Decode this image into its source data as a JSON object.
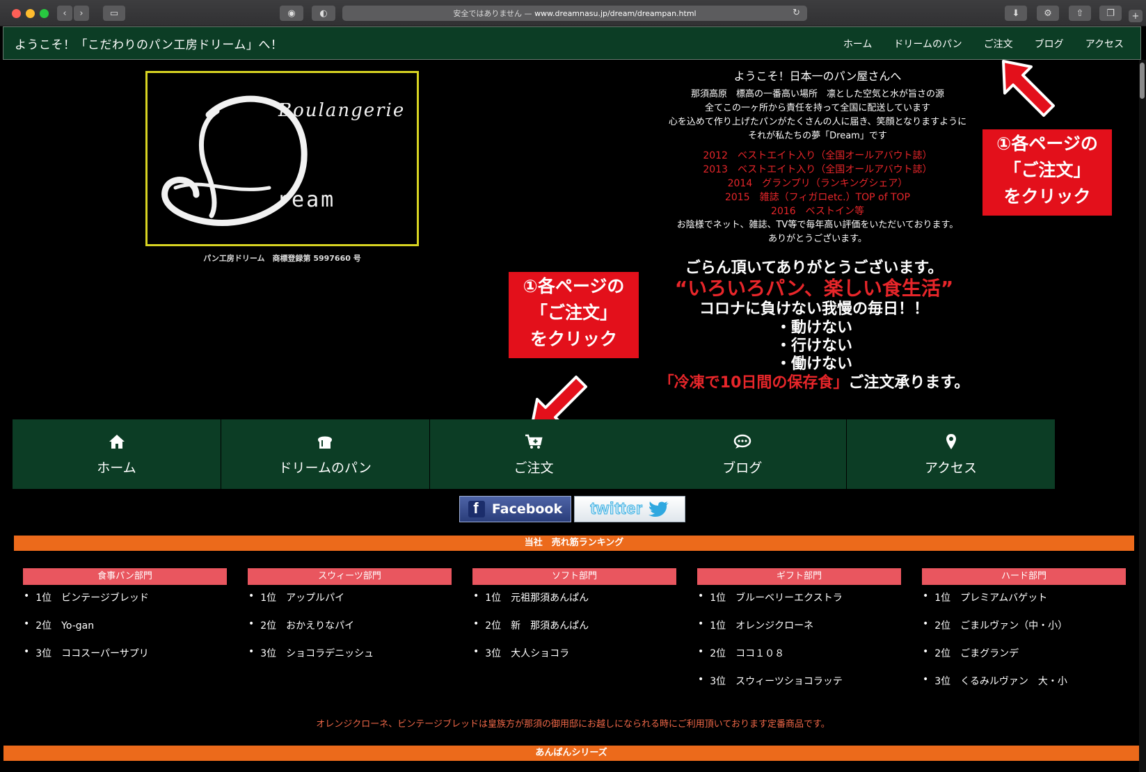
{
  "browser": {
    "url_prefix": "安全ではありません —",
    "url_host_path": "www.dreamnasu.jp/dream/dreampan.html"
  },
  "header": {
    "title": "ようこそ！「こだわりのパン工房ドリーム」へ！",
    "nav": [
      "ホーム",
      "ドリームのパン",
      "ご注文",
      "ブログ",
      "アクセス"
    ]
  },
  "logo": {
    "line1": "Boulangerie",
    "line2": "ream",
    "caption": "パン工房ドリーム　商標登録第 5997660 号"
  },
  "intro": {
    "title": "ようこそ！日本一のパン屋さんへ",
    "lines": [
      "那須高原　標高の一番高い場所　凛とした空気と水が旨さの源",
      "全てこの一ヶ所から責任を持って全国に配送しています",
      "心を込めて作り上げたパンがたくさんの人に届き、笑顔となりますように",
      "それが私たちの夢「Dream」です"
    ],
    "awards": [
      "2012　ベストエイト入り（全国オールアバウト誌）",
      "2013　ベストエイト入り（全国オールアバウト誌）",
      "2014　グランプリ（ランキングシェア）",
      "2015　雑誌（フィガロetc.）TOP of TOP",
      "2016　ベストイン等"
    ],
    "praise": [
      "お陰様でネット、雑誌、TV等で毎年高い評価をいただいております。",
      "ありがとうございます。"
    ]
  },
  "message": {
    "thanks": "ごらん頂いてありがとうございます。",
    "catch": "“いろいろパン、楽しい食生活”",
    "corona": "コロナに負けない我慢の毎日！！",
    "bullets": [
      "・動けない",
      "・行けない",
      "・働けない"
    ],
    "final_red": "「冷凍で10日間の保存食」",
    "final": "ご注文承ります。"
  },
  "callouts": {
    "right": [
      "①各ページの",
      "「ご注文」",
      "をクリック"
    ],
    "mid": [
      "①各ページの",
      "「ご注文」",
      "をクリック"
    ]
  },
  "tiles": [
    {
      "label": "ホーム",
      "icon": "home-icon"
    },
    {
      "label": "ドリームのパン",
      "icon": "bread-icon"
    },
    {
      "label": "ご注文",
      "icon": "cart-plus-icon"
    },
    {
      "label": "ブログ",
      "icon": "chat-icon"
    },
    {
      "label": "アクセス",
      "icon": "map-marker-icon"
    }
  ],
  "social": {
    "facebook": "Facebook",
    "twitter": "twitter"
  },
  "ranking": {
    "title": "当社　売れ筋ランキング",
    "columns": [
      {
        "head": "食事パン部門",
        "items": [
          "1位　ビンテージブレッド",
          "2位　Yo-gan",
          "3位　ココスーパーサプリ"
        ]
      },
      {
        "head": "スウィーツ部門",
        "items": [
          "1位　アップルパイ",
          "2位　おかえりなパイ",
          "3位　ショコラデニッシュ"
        ]
      },
      {
        "head": "ソフト部門",
        "items": [
          "1位　元祖那須あんぱん",
          "2位　新　那須あんぱん",
          "3位　大人ショコラ"
        ]
      },
      {
        "head": "ギフト部門",
        "items": [
          "1位　ブルーベリーエクストラ",
          "1位　オレンジクローネ",
          "2位　ココ１０８",
          "3位　スウィーツショコラッテ"
        ]
      },
      {
        "head": "ハード部門",
        "items": [
          "1位　プレミアムバゲット",
          "2位　ごまルヴァン（中・小）",
          "2位　ごまグランデ",
          "3位　くるみルヴァン　大・小"
        ]
      }
    ],
    "footnote": "オレンジクローネ、ビンテージブレッドは皇族方が那須の御用邸にお越しになられる時にご利用頂いております定番商品です。"
  },
  "anpan": {
    "title": "あんぱんシリーズ"
  },
  "colors": {
    "header_green": "#0c3d25",
    "accent_red": "#e3101b",
    "orange": "#ec6a1b",
    "rank_pink": "#e9565f"
  }
}
